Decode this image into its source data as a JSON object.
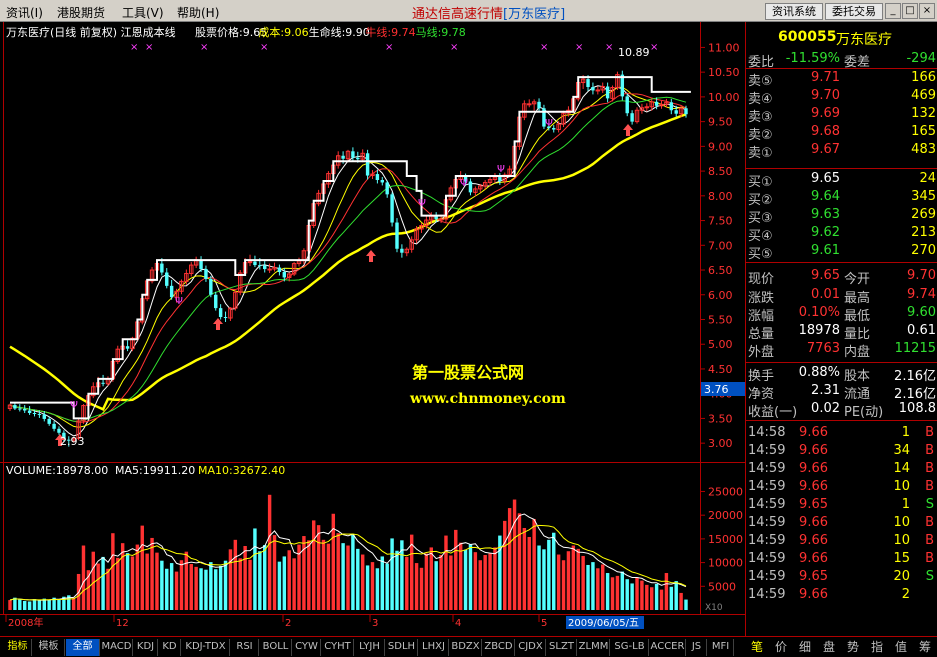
{
  "menu": {
    "items": [
      "资讯(I)",
      "港股期货",
      "工具(V)",
      "帮助(H)"
    ],
    "title": "通达信高速行情",
    "title_stock": "[万东医疗]",
    "btn_news": "资讯系统",
    "btn_trade": "委托交易"
  },
  "chart": {
    "header": "万东医疗(日线 前复权) 江恩成本线",
    "header_items": [
      {
        "label": "股票价格:9.65",
        "color": "#ffffff"
      },
      {
        "label": "成本:9.06",
        "color": "#ffff00"
      },
      {
        "label": "生命线:9.90",
        "color": "#ffffff"
      },
      {
        "label": "牛线:9.74",
        "color": "#ff3030"
      },
      {
        "label": "马线:9.78",
        "color": "#30e030"
      }
    ],
    "high_label": "10.89",
    "low_label": "2.93",
    "price_marker": "3.76",
    "watermark_line1": "第一股票公式网",
    "watermark_line2": "www.chnmoney.com",
    "date_label": "2009/06/05/五",
    "vol_header": [
      {
        "label": "VOLUME:18978.00",
        "color": "#ffffff"
      },
      {
        "label": "MA5:19911.20",
        "color": "#ffffff"
      },
      {
        "label": "MA10:32672.40",
        "color": "#ffff00"
      }
    ],
    "vol_tag": "X10"
  },
  "chart_data": {
    "type": "candlestick",
    "price_axis": [
      11,
      10.5,
      10,
      9.5,
      9,
      8.5,
      8,
      7.5,
      7,
      6.5,
      6,
      5.5,
      5,
      4.5,
      4,
      3.5,
      3
    ],
    "price_ylim": [
      2.7,
      11.15
    ],
    "volume_axis": [
      25000,
      20000,
      15000,
      10000,
      5000
    ],
    "volume_ylim": [
      0,
      27000
    ],
    "x_labels": [
      "2008年",
      "12",
      "2",
      "3",
      "4",
      "5"
    ],
    "open": [
      3.7,
      3.77,
      3.7,
      3.69,
      3.66,
      3.61,
      3.59,
      3.58,
      3.49,
      3.39,
      3.29,
      3.21,
      3.07,
      3.06,
      3.1,
      3.45,
      3.76,
      3.96,
      4.14,
      4.22,
      4.2,
      4.3,
      4.65,
      4.9,
      4.96,
      4.91,
      5.12,
      5.45,
      5.92,
      6.28,
      6.5,
      6.63,
      6.45,
      6.18,
      5.95,
      6.07,
      6.27,
      6.43,
      6.6,
      6.71,
      6.52,
      6.32,
      6.0,
      5.73,
      5.55,
      5.53,
      5.73,
      6.05,
      6.44,
      6.65,
      6.67,
      6.6,
      6.59,
      6.52,
      6.52,
      6.55,
      6.46,
      6.35,
      6.42,
      6.63,
      6.69,
      6.89,
      7.4,
      7.84,
      8.05,
      8.24,
      8.45,
      8.62,
      8.81,
      8.75,
      8.9,
      8.77,
      8.74,
      8.86,
      8.41,
      8.44,
      8.32,
      8.27,
      8.03,
      7.46,
      6.93,
      6.85,
      6.92,
      7.11,
      7.33,
      7.4,
      7.51,
      7.59,
      7.53,
      7.53,
      7.92,
      8.16,
      8.33,
      8.4,
      8.29,
      8.07,
      8.14,
      8.2,
      8.27,
      8.33,
      8.38,
      8.3,
      8.42,
      8.54,
      9.0,
      9.59,
      9.86,
      9.86,
      9.9,
      9.77,
      9.4,
      9.37,
      9.34,
      9.45,
      9.67,
      9.73,
      9.96,
      10.29,
      10.36,
      10.2,
      10.13,
      10.14,
      10.21,
      9.97,
      10.19,
      10.45,
      10.01,
      9.67,
      9.5,
      9.73,
      9.78,
      9.8,
      9.9,
      9.82,
      9.85,
      9.89,
      9.73,
      9.66,
      9.77
    ],
    "high": [
      3.8,
      3.82,
      3.79,
      3.77,
      3.75,
      3.68,
      3.66,
      3.65,
      3.54,
      3.45,
      3.34,
      3.26,
      3.14,
      3.12,
      3.49,
      3.79,
      4.0,
      4.23,
      4.34,
      4.38,
      4.35,
      4.69,
      4.97,
      5.12,
      5.08,
      5.15,
      5.48,
      5.99,
      6.32,
      6.56,
      6.71,
      6.74,
      6.54,
      6.3,
      6.12,
      6.31,
      6.51,
      6.66,
      6.77,
      6.78,
      6.59,
      6.38,
      6.06,
      5.81,
      5.66,
      5.75,
      6.09,
      6.5,
      6.74,
      6.81,
      6.79,
      6.74,
      6.7,
      6.63,
      6.65,
      6.61,
      6.54,
      6.45,
      6.66,
      6.75,
      6.94,
      7.45,
      7.89,
      8.12,
      8.31,
      8.5,
      8.69,
      8.9,
      8.9,
      8.93,
      8.98,
      8.89,
      8.94,
      8.93,
      8.52,
      8.53,
      8.38,
      8.31,
      8.07,
      7.55,
      7.02,
      6.96,
      7.18,
      7.39,
      7.45,
      7.59,
      7.67,
      7.67,
      7.62,
      7.96,
      8.21,
      8.39,
      8.5,
      8.45,
      8.35,
      8.19,
      8.24,
      8.32,
      8.4,
      8.46,
      8.46,
      8.47,
      8.61,
      9.05,
      9.65,
      9.93,
      9.95,
      9.95,
      9.97,
      9.84,
      9.46,
      9.43,
      9.51,
      9.72,
      9.81,
      10.02,
      10.35,
      10.44,
      10.44,
      10.29,
      10.21,
      10.29,
      10.29,
      10.23,
      10.51,
      10.53,
      10.07,
      9.73,
      9.79,
      9.86,
      9.87,
      9.96,
      9.99,
      9.92,
      9.96,
      9.96,
      9.82,
      9.81,
      9.82
    ],
    "low": [
      3.65,
      3.67,
      3.64,
      3.61,
      3.57,
      3.54,
      3.51,
      3.44,
      3.35,
      3.24,
      3.17,
      3.03,
      2.93,
      3.01,
      3.06,
      3.39,
      3.71,
      3.91,
      4.06,
      4.15,
      4.16,
      4.24,
      4.6,
      4.85,
      4.86,
      4.86,
      5.07,
      5.4,
      5.87,
      6.23,
      6.45,
      6.39,
      6.13,
      5.9,
      5.84,
      6.01,
      6.2,
      6.37,
      6.54,
      6.46,
      6.26,
      5.95,
      5.68,
      5.5,
      5.45,
      5.47,
      5.68,
      5.99,
      6.39,
      6.58,
      6.56,
      6.51,
      6.45,
      6.44,
      6.47,
      6.39,
      6.27,
      6.27,
      6.38,
      6.57,
      6.62,
      6.83,
      7.35,
      7.79,
      7.98,
      8.16,
      8.38,
      8.55,
      8.65,
      8.68,
      8.7,
      8.67,
      8.68,
      8.33,
      8.34,
      8.25,
      8.21,
      7.96,
      7.38,
      6.86,
      6.75,
      6.78,
      6.85,
      7.04,
      7.25,
      7.34,
      7.44,
      7.46,
      7.45,
      7.47,
      7.87,
      8.1,
      8.28,
      8.22,
      8.01,
      7.99,
      8.07,
      8.13,
      8.2,
      8.26,
      8.22,
      8.23,
      8.37,
      8.48,
      8.93,
      9.53,
      9.79,
      9.72,
      9.69,
      9.35,
      9.32,
      9.28,
      9.28,
      9.39,
      9.6,
      9.67,
      9.91,
      10.16,
      10.12,
      10.05,
      10.05,
      10.08,
      9.89,
      9.91,
      10.14,
      9.93,
      9.61,
      9.44,
      9.46,
      9.66,
      9.71,
      9.72,
      9.75,
      9.76,
      9.79,
      9.65,
      9.6,
      9.59,
      9.58
    ],
    "close": [
      3.77,
      3.7,
      3.69,
      3.66,
      3.61,
      3.59,
      3.58,
      3.49,
      3.39,
      3.29,
      3.21,
      3.07,
      3.06,
      3.1,
      3.45,
      3.76,
      3.96,
      4.14,
      4.22,
      4.2,
      4.3,
      4.65,
      4.9,
      4.96,
      4.91,
      5.12,
      5.45,
      5.92,
      6.28,
      6.5,
      6.63,
      6.45,
      6.18,
      5.95,
      6.07,
      6.27,
      6.43,
      6.6,
      6.71,
      6.52,
      6.32,
      6.0,
      5.73,
      5.55,
      5.53,
      5.73,
      6.05,
      6.44,
      6.65,
      6.67,
      6.6,
      6.59,
      6.52,
      6.52,
      6.55,
      6.46,
      6.35,
      6.42,
      6.63,
      6.69,
      6.89,
      7.4,
      7.84,
      8.05,
      8.24,
      8.45,
      8.62,
      8.81,
      8.75,
      8.9,
      8.77,
      8.74,
      8.86,
      8.41,
      8.44,
      8.32,
      8.27,
      8.03,
      7.46,
      6.93,
      6.85,
      6.92,
      7.11,
      7.33,
      7.4,
      7.51,
      7.59,
      7.53,
      7.53,
      7.92,
      8.16,
      8.33,
      8.4,
      8.29,
      8.07,
      8.14,
      8.2,
      8.27,
      8.33,
      8.38,
      8.3,
      8.42,
      8.54,
      9.0,
      9.59,
      9.86,
      9.86,
      9.9,
      9.77,
      9.4,
      9.37,
      9.34,
      9.45,
      9.67,
      9.73,
      9.96,
      10.29,
      10.36,
      10.2,
      10.13,
      10.14,
      10.21,
      9.97,
      10.19,
      10.45,
      10.01,
      9.67,
      9.5,
      9.73,
      9.78,
      9.8,
      9.9,
      9.82,
      9.85,
      9.89,
      9.73,
      9.66,
      9.77,
      9.65
    ],
    "volume": [
      2100,
      2600,
      2200,
      1900,
      1800,
      2300,
      2000,
      2400,
      2100,
      2600,
      2300,
      2800,
      3100,
      2500,
      7600,
      13600,
      8400,
      12300,
      9800,
      11200,
      8700,
      16200,
      11000,
      14100,
      12000,
      11300,
      13800,
      17800,
      11900,
      15200,
      12100,
      10400,
      8700,
      9900,
      8100,
      10500,
      12300,
      9700,
      9100,
      8800,
      8500,
      10100,
      8600,
      9300,
      10400,
      12800,
      14800,
      10900,
      13500,
      10600,
      17200,
      12400,
      13700,
      24300,
      15800,
      10200,
      11300,
      12600,
      10900,
      13800,
      15600,
      14700,
      18900,
      17900,
      14800,
      14000,
      20300,
      16200,
      14100,
      13600,
      15900,
      12900,
      11700,
      9400,
      10100,
      8800,
      11300,
      9800,
      15100,
      12500,
      14700,
      11200,
      15900,
      9900,
      8900,
      11900,
      13200,
      10300,
      11600,
      15700,
      11500,
      16900,
      14200,
      12700,
      13800,
      12200,
      10500,
      11600,
      11900,
      13200,
      15700,
      18800,
      21500,
      23300,
      20400,
      17300,
      15400,
      19200,
      13600,
      12800,
      14800,
      16300,
      11700,
      10500,
      12400,
      13600,
      12900,
      11400,
      9500,
      10100,
      8800,
      9600,
      7800,
      6900,
      7200,
      8100,
      6500,
      5600,
      6900,
      6200,
      5300,
      4800,
      5500,
      4300,
      7800,
      4900,
      6100,
      3600,
      2200
    ]
  },
  "right": {
    "code": "600055",
    "name": "万东医疗",
    "rows": [
      {
        "label": "委比",
        "val": "-11.59%",
        "label2": "委差",
        "val2": "-294"
      },
      {
        "label": "卖⑤",
        "val": "9.71",
        "val2": "166"
      },
      {
        "label": "卖④",
        "val": "9.70",
        "val2": "469"
      },
      {
        "label": "卖③",
        "val": "9.69",
        "val2": "132"
      },
      {
        "label": "卖②",
        "val": "9.68",
        "val2": "165"
      },
      {
        "label": "卖①",
        "val": "9.67",
        "val2": "483"
      },
      {
        "label": "买①",
        "val": "9.65",
        "val2": "24"
      },
      {
        "label": "买②",
        "val": "9.64",
        "val2": "345"
      },
      {
        "label": "买③",
        "val": "9.63",
        "val2": "269"
      },
      {
        "label": "买④",
        "val": "9.62",
        "val2": "213"
      },
      {
        "label": "买⑤",
        "val": "9.61",
        "val2": "270"
      },
      {
        "label": "现价",
        "val": "9.65",
        "label2": "今开",
        "val2": "9.70"
      },
      {
        "label": "涨跌",
        "val": "0.01",
        "label2": "最高",
        "val2": "9.74"
      },
      {
        "label": "涨幅",
        "val": "0.10%",
        "label2": "最低",
        "val2": "9.60"
      },
      {
        "label": "总量",
        "val": "18978",
        "label2": "量比",
        "val2": "0.61"
      },
      {
        "label": "外盘",
        "val": "7763",
        "label2": "内盘",
        "val2": "11215"
      },
      {
        "label": "换手",
        "val": "0.88%",
        "label2": "股本",
        "val2": "2.16亿"
      },
      {
        "label": "净资",
        "val": "2.31",
        "label2": "流通",
        "val2": "2.16亿"
      },
      {
        "label": "收益(一)",
        "val": "0.02",
        "label2": "PE(动)",
        "val2": "108.8"
      }
    ],
    "trades": [
      [
        "14:58",
        "9.66",
        "1",
        "B"
      ],
      [
        "14:59",
        "9.66",
        "34",
        "B"
      ],
      [
        "14:59",
        "9.66",
        "14",
        "B"
      ],
      [
        "14:59",
        "9.66",
        "10",
        "B"
      ],
      [
        "14:59",
        "9.65",
        "1",
        "S"
      ],
      [
        "14:59",
        "9.66",
        "10",
        "B"
      ],
      [
        "14:59",
        "9.66",
        "10",
        "B"
      ],
      [
        "14:59",
        "9.66",
        "15",
        "B"
      ],
      [
        "14:59",
        "9.65",
        "20",
        "S"
      ],
      [
        "14:59",
        "9.66",
        "2",
        ""
      ]
    ]
  },
  "bottom": {
    "tabs": [
      "指标",
      "模板",
      "全部",
      "MACD",
      "KDJ",
      "KD",
      "KDJ-TDX",
      "RSI",
      "BOLL",
      "CYW",
      "CYHT",
      "LYJH",
      "SDLH",
      "LHXJ",
      "BDZX",
      "ZBCD",
      "CJDX",
      "SLZT",
      "ZLMM",
      "SG-LB",
      "ACCER",
      "JS",
      "MFI"
    ],
    "right_tabs": [
      "笔",
      "价",
      "细",
      "盘",
      "势",
      "指",
      "值",
      "筹"
    ]
  },
  "colors": {
    "up": "#ff3232",
    "down": "#54ffff",
    "grid": "#b00000",
    "yellow": "#ffff00",
    "white": "#ffffff",
    "green": "#30e030"
  }
}
